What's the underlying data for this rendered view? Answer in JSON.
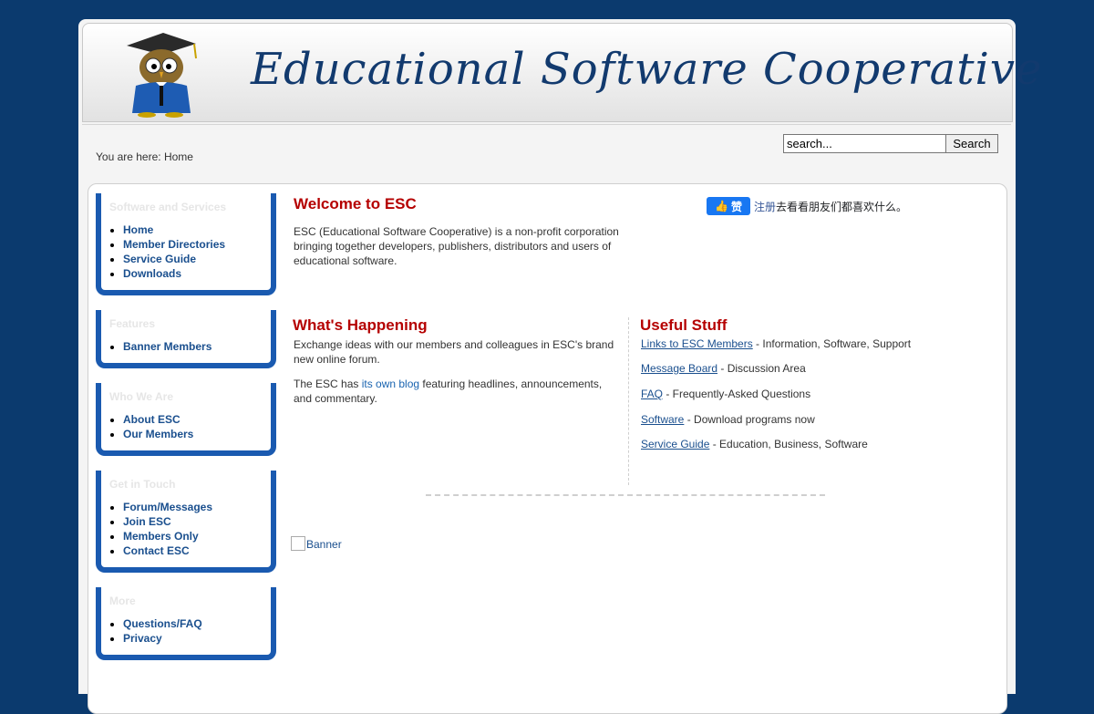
{
  "header": {
    "site_title": "Educational Software Cooperative"
  },
  "breadcrumb": "You are here: Home",
  "search": {
    "value": "search...",
    "button": "Search"
  },
  "sidebar": [
    {
      "title": "Software and Services",
      "items": [
        "Home",
        "Member Directories",
        "Service Guide",
        "Downloads"
      ]
    },
    {
      "title": "Features",
      "items": [
        "Banner Members"
      ]
    },
    {
      "title": "Who We Are",
      "items": [
        "About ESC",
        "Our Members"
      ]
    },
    {
      "title": "Get in Touch",
      "items": [
        "Forum/Messages",
        "Join ESC",
        "Members Only",
        "Contact ESC"
      ]
    },
    {
      "title": "More",
      "items": [
        "Questions/FAQ",
        "Privacy"
      ]
    }
  ],
  "welcome": {
    "title": "Welcome to ESC",
    "text": "ESC (Educational Software Cooperative) is a non-profit corporation bringing together developers, publishers, distributors and users of educational software."
  },
  "facebook": {
    "like": "赞",
    "link": "注册",
    "text": "去看看朋友们都喜欢什么。"
  },
  "happening": {
    "title": "What's Happening",
    "p1": "Exchange ideas with our members and colleagues in ESC's brand new online forum.",
    "p2_before": "The ESC has ",
    "p2_link": "its own blog",
    "p2_after": " featuring headlines, announcements, and commentary."
  },
  "useful": {
    "title": "Useful Stuff",
    "items": [
      {
        "link": "Links to ESC Members",
        "desc": " - Information, Software, Support"
      },
      {
        "link": "Message Board",
        "desc": " - Discussion Area"
      },
      {
        "link": "FAQ",
        "desc": " - Frequently-Asked Questions"
      },
      {
        "link": "Software",
        "desc": " - Download programs now"
      },
      {
        "link": "Service Guide",
        "desc": " - Education, Business, Software"
      }
    ]
  },
  "banner_alt": "Banner"
}
